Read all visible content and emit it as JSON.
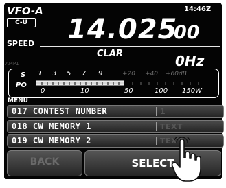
{
  "header": {
    "vfo_label": "VFO-A",
    "vfo_mode": "C-U",
    "time": "14:46Z",
    "speed_label": "SPEED"
  },
  "frequency": {
    "main": "14.025",
    "sub": "00"
  },
  "clar": {
    "label": "CLAR",
    "value": "0Hz"
  },
  "amp_label": "AMP1",
  "meter": {
    "s_label": "S",
    "po_label": "PO",
    "s_scale": [
      "1",
      "3",
      "5",
      "7",
      "9",
      "+20",
      "+40",
      "+60dB"
    ],
    "po_scale": [
      "0",
      "10",
      "50",
      "100",
      "150W"
    ]
  },
  "menu": {
    "title": "MENU",
    "items": [
      {
        "number": "017",
        "label": "017 CONTEST NUMBER",
        "value": "1"
      },
      {
        "number": "018",
        "label": "018 CW MEMORY 1",
        "value": "TEXT"
      },
      {
        "number": "019",
        "label": "019 CW MEMORY 2",
        "value": "TEXT"
      }
    ]
  },
  "buttons": {
    "back": "BACK",
    "select": "SELECT"
  },
  "colors": {
    "screen_bg": "#040404",
    "text": "#ffffff",
    "dim_text": "#555555"
  }
}
